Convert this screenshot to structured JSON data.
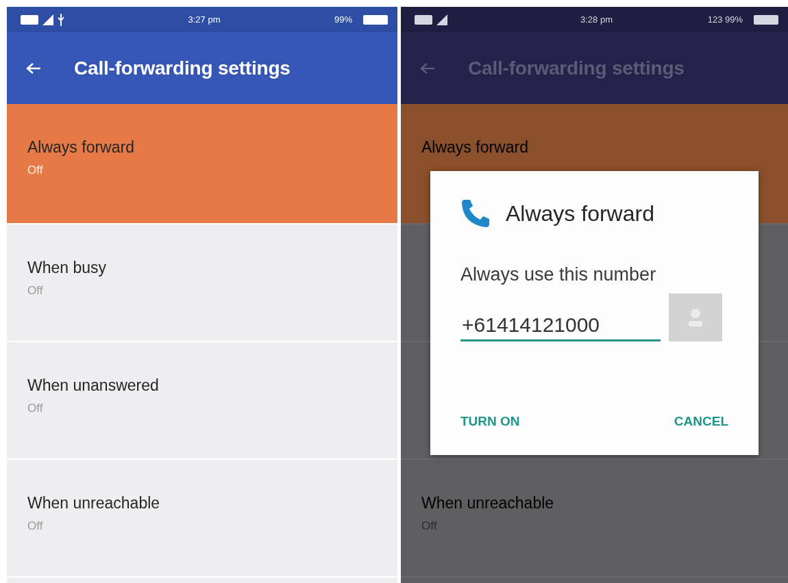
{
  "screens": [
    {
      "dimmed": false,
      "status_bar": {
        "time": "3:27 pm",
        "battery": "99%",
        "usb": true
      },
      "app_bar": {
        "title": "Call-forwarding settings"
      },
      "items": [
        {
          "kind": "row",
          "title": "Always forward",
          "value": "Off",
          "selected": true
        },
        {
          "kind": "row",
          "title": "When busy",
          "value": "Off",
          "selected": false
        },
        {
          "kind": "row",
          "title": "When unanswered",
          "value": "Off",
          "selected": false
        },
        {
          "kind": "row",
          "title": "When unreachable",
          "value": "Off",
          "selected": false
        }
      ]
    },
    {
      "dimmed": true,
      "status_bar": {
        "time": "3:28 pm",
        "battery": "123 99%"
      },
      "app_bar": {
        "title": "Call-forwarding settings"
      },
      "items": [
        {
          "kind": "row",
          "title": "Always forward",
          "selected": true
        },
        {
          "kind": "covered"
        },
        {
          "kind": "covered"
        },
        {
          "kind": "row",
          "title": "When unreachable",
          "value": "Off",
          "selected": false
        }
      ],
      "dialog": {
        "title": "Always forward",
        "message": "Always use this number",
        "number": "+61414121000",
        "buttons": [
          {
            "label": "TURN ON"
          },
          {
            "label": "CANCEL"
          }
        ]
      }
    }
  ]
}
